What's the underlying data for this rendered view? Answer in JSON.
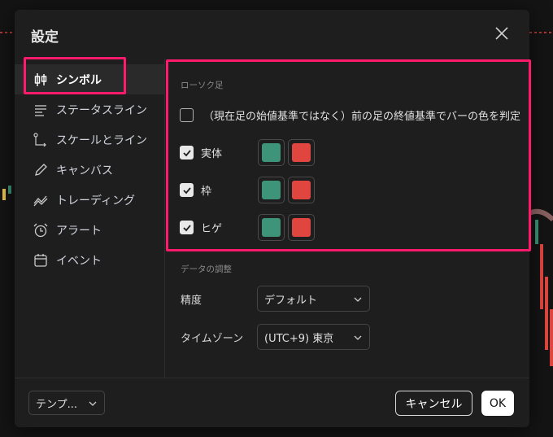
{
  "dialog": {
    "title": "設定"
  },
  "sidebar": {
    "items": [
      {
        "label": "シンボル",
        "icon": "candlestick-icon",
        "active": true
      },
      {
        "label": "ステータスライン",
        "icon": "status-line-icon",
        "active": false
      },
      {
        "label": "スケールとライン",
        "icon": "scales-icon",
        "active": false
      },
      {
        "label": "キャンバス",
        "icon": "pencil-icon",
        "active": false
      },
      {
        "label": "トレーディング",
        "icon": "trading-icon",
        "active": false
      },
      {
        "label": "アラート",
        "icon": "alarm-clock-icon",
        "active": false
      },
      {
        "label": "イベント",
        "icon": "calendar-icon",
        "active": false
      }
    ]
  },
  "candles": {
    "section_label": "ローソク足",
    "prev_close_label": "（現在足の始値基準ではなく）前の足の終値基準でバーの色を判定",
    "prev_close_checked": false,
    "rows": [
      {
        "label": "実体",
        "checked": true,
        "up_color": "#3d9478",
        "down_color": "#e0463f"
      },
      {
        "label": "枠",
        "checked": true,
        "up_color": "#3d9478",
        "down_color": "#e0463f"
      },
      {
        "label": "ヒゲ",
        "checked": true,
        "up_color": "#3d9478",
        "down_color": "#e0463f"
      }
    ]
  },
  "data_adjust": {
    "section_label": "データの調整",
    "precision_label": "精度",
    "precision_value": "デフォルト",
    "timezone_label": "タイムゾーン",
    "timezone_value": "(UTC+9) 東京"
  },
  "footer": {
    "template_label": "テンプ...",
    "cancel_label": "キャンセル",
    "ok_label": "OK"
  },
  "colors": {
    "highlight": "#ff1a6c",
    "dialog_bg": "#1e1e1e",
    "up": "#3d9478",
    "down": "#e0463f"
  }
}
